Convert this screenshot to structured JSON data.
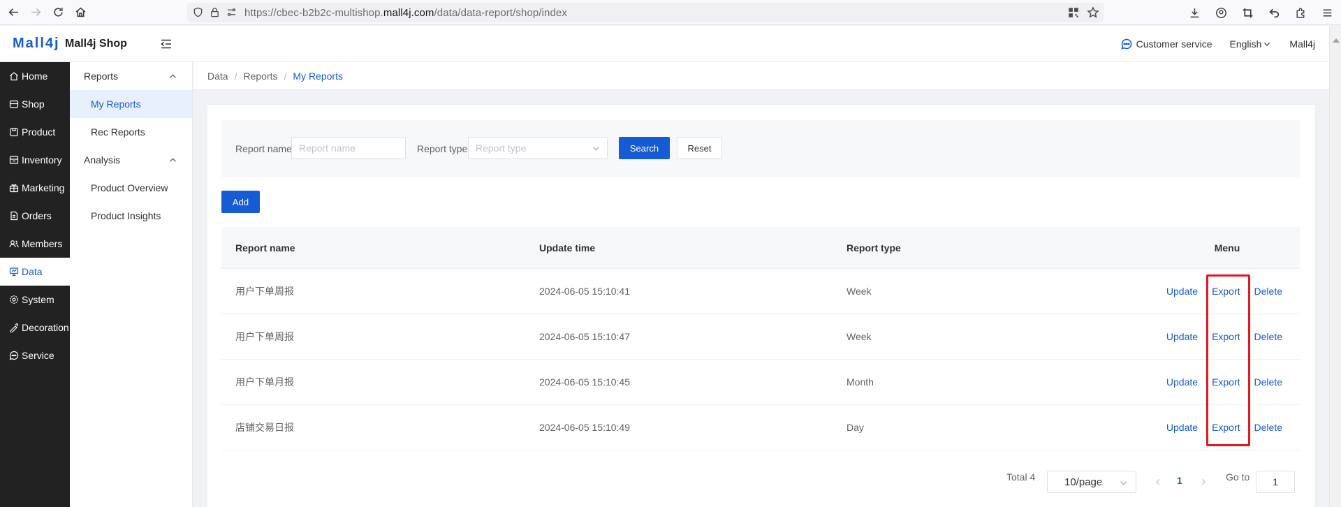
{
  "browser": {
    "url_prefix": "https://cbec-b2b2c-multishop.",
    "url_domain": "mall4j.com",
    "url_path": "/data/data-report/shop/index"
  },
  "header": {
    "logo": "Mall4j",
    "shop_name": "Mall4j Shop",
    "customer_service": "Customer service",
    "language": "English",
    "user": "Mall4j"
  },
  "sidebar": {
    "items": [
      {
        "label": "Home",
        "icon": "home-icon"
      },
      {
        "label": "Shop",
        "icon": "shop-icon"
      },
      {
        "label": "Product",
        "icon": "product-icon"
      },
      {
        "label": "Inventory",
        "icon": "inventory-icon"
      },
      {
        "label": "Marketing",
        "icon": "marketing-icon"
      },
      {
        "label": "Orders",
        "icon": "orders-icon"
      },
      {
        "label": "Members",
        "icon": "members-icon"
      },
      {
        "label": "Data",
        "icon": "data-icon",
        "active": true
      },
      {
        "label": "System",
        "icon": "system-icon"
      },
      {
        "label": "Decoration",
        "icon": "decoration-icon"
      },
      {
        "label": "Service",
        "icon": "service-icon"
      }
    ]
  },
  "subnav": {
    "groups": [
      {
        "label": "Reports",
        "items": [
          "My Reports",
          "Rec Reports"
        ]
      },
      {
        "label": "Analysis",
        "items": [
          "Product Overview",
          "Product Insights"
        ]
      }
    ],
    "active_item": "My Reports"
  },
  "breadcrumb": [
    "Data",
    "Reports",
    "My Reports"
  ],
  "search": {
    "name_label": "Report name:",
    "name_placeholder": "Report name",
    "type_label": "Report type:",
    "type_placeholder": "Report type",
    "search_button": "Search",
    "reset_button": "Reset"
  },
  "add_button": "Add",
  "table": {
    "columns": [
      "Report name",
      "Update time",
      "Report type",
      "Menu"
    ],
    "rows": [
      {
        "name": "用户下单周报",
        "time": "2024-06-05 15:10:41",
        "type": "Week"
      },
      {
        "name": "用户下单周报",
        "time": "2024-06-05 15:10:47",
        "type": "Week"
      },
      {
        "name": "用户下单月报",
        "time": "2024-06-05 15:10:45",
        "type": "Month"
      },
      {
        "name": "店铺交易日报",
        "time": "2024-06-05 15:10:49",
        "type": "Day"
      }
    ],
    "actions": [
      "Update",
      "Export",
      "Delete"
    ]
  },
  "pagination": {
    "total": "Total 4",
    "page_size": "10/page",
    "current_page": "1",
    "goto_label": "Go to",
    "goto_value": "1"
  },
  "colors": {
    "primary": "#155bd4",
    "sidebar_bg": "#222222",
    "highlight": "#e8141e"
  }
}
